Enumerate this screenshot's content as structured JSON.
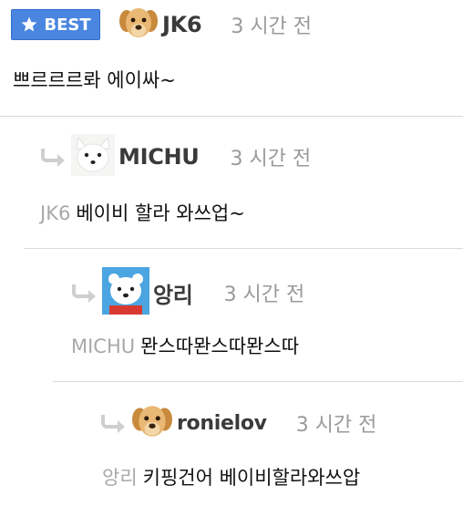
{
  "comments": [
    {
      "badge": "BEST",
      "author": "JK6",
      "time": "3 시간 전",
      "mention": "",
      "text": "쁘르르르롸 에이싸~"
    },
    {
      "author": "MICHU",
      "time": "3 시간 전",
      "mention": "JK6",
      "text": "베이비 할라 와쓰업~"
    },
    {
      "author": "앙리",
      "time": "3 시간 전",
      "mention": "MICHU",
      "text": "뫈스따뫈스따뫈스따"
    },
    {
      "author": "ronielov",
      "time": "3 시간 전",
      "mention": "앙리",
      "text": "키핑건어 베이비할라와쓰압"
    }
  ],
  "icons": {
    "badge_star": "star-icon",
    "reply": "reply-arrow-icon",
    "avatar_puppy": "puppy-avatar",
    "avatar_fox": "arctic-fox-avatar",
    "avatar_bear": "polar-bear-avatar"
  },
  "colors": {
    "badge_bg": "#4a86e0",
    "reply_arrow": "#cfcfcf",
    "time": "#9a9a9a",
    "mention": "#a8a8a8"
  }
}
